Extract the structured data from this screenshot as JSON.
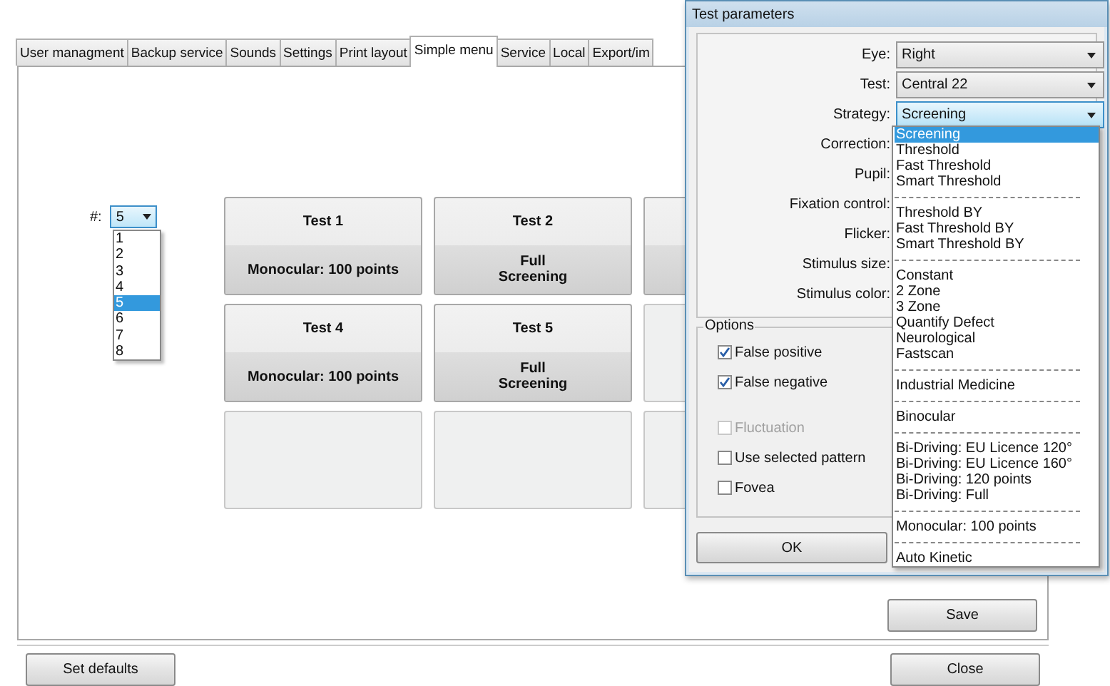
{
  "tabs": [
    {
      "label": "User managment",
      "selected": false
    },
    {
      "label": "Backup service",
      "selected": false
    },
    {
      "label": "Sounds",
      "selected": false
    },
    {
      "label": "Settings",
      "selected": false
    },
    {
      "label": "Print layout",
      "selected": false
    },
    {
      "label": "Simple menu",
      "selected": true
    },
    {
      "label": "Service",
      "selected": false
    },
    {
      "label": "Local",
      "selected": false
    },
    {
      "label": "Export/im",
      "selected": false
    }
  ],
  "count_selector": {
    "label": "#:",
    "value": "5",
    "options": [
      {
        "label": "1",
        "selected": false
      },
      {
        "label": "2",
        "selected": false
      },
      {
        "label": "3",
        "selected": false
      },
      {
        "label": "4",
        "selected": false
      },
      {
        "label": "5",
        "selected": true
      },
      {
        "label": "6",
        "selected": false
      },
      {
        "label": "7",
        "selected": false
      },
      {
        "label": "8",
        "selected": false
      }
    ]
  },
  "tiles": [
    {
      "kind": "test",
      "title": "Test 1",
      "subtitle": "Monocular: 100 points"
    },
    {
      "kind": "test",
      "title": "Test 2",
      "subtitle": "Full\nScreening"
    },
    {
      "kind": "test"
    },
    {
      "kind": "test",
      "title": "Test 4",
      "subtitle": "Monocular: 100 points"
    },
    {
      "kind": "test",
      "title": "Test 5",
      "subtitle": "Full\nScreening"
    },
    {
      "kind": "empty"
    },
    {
      "kind": "empty"
    },
    {
      "kind": "empty"
    },
    {
      "kind": "empty"
    }
  ],
  "save_button": "Save",
  "set_defaults_button": "Set defaults",
  "close_button": "Close",
  "dialog": {
    "title": "Test parameters",
    "fields": [
      {
        "label": "Eye:",
        "value": "Right",
        "focused": false
      },
      {
        "label": "Test:",
        "value": "Central 22",
        "focused": false
      },
      {
        "label": "Strategy:",
        "value": "Screening",
        "focused": true
      },
      {
        "label": "Correction:"
      },
      {
        "label": "Pupil:"
      },
      {
        "label": "Fixation control:"
      },
      {
        "label": "Flicker:"
      },
      {
        "label": "Stimulus size:"
      },
      {
        "label": "Stimulus color:"
      }
    ],
    "options_title": "Options",
    "options": [
      {
        "label": "False positive",
        "checked": true,
        "disabled": false
      },
      {
        "label": "False negative",
        "checked": true,
        "disabled": false
      },
      {
        "label": "Fluctuation",
        "checked": false,
        "disabled": true
      },
      {
        "label": "Use selected pattern",
        "checked": false,
        "disabled": false
      },
      {
        "label": "Fovea",
        "checked": false,
        "disabled": false
      }
    ],
    "ok_button": "OK",
    "strategy_list": [
      {
        "kind": "option",
        "label": "Screening",
        "selected": true
      },
      {
        "kind": "option",
        "label": "Threshold",
        "selected": false
      },
      {
        "kind": "option",
        "label": "Fast Threshold",
        "selected": false
      },
      {
        "kind": "option",
        "label": "Smart Threshold",
        "selected": false
      },
      {
        "kind": "separator"
      },
      {
        "kind": "option",
        "label": "Threshold BY",
        "selected": false
      },
      {
        "kind": "option",
        "label": "Fast Threshold BY",
        "selected": false
      },
      {
        "kind": "option",
        "label": "Smart Threshold BY",
        "selected": false
      },
      {
        "kind": "separator"
      },
      {
        "kind": "option",
        "label": "Constant",
        "selected": false
      },
      {
        "kind": "option",
        "label": "2 Zone",
        "selected": false
      },
      {
        "kind": "option",
        "label": "3 Zone",
        "selected": false
      },
      {
        "kind": "option",
        "label": "Quantify Defect",
        "selected": false
      },
      {
        "kind": "option",
        "label": "Neurological",
        "selected": false
      },
      {
        "kind": "option",
        "label": "Fastscan",
        "selected": false
      },
      {
        "kind": "separator"
      },
      {
        "kind": "option",
        "label": "Industrial Medicine",
        "selected": false
      },
      {
        "kind": "separator"
      },
      {
        "kind": "option",
        "label": "Binocular",
        "selected": false
      },
      {
        "kind": "separator"
      },
      {
        "kind": "option",
        "label": "Bi-Driving: EU Licence 120°",
        "selected": false
      },
      {
        "kind": "option",
        "label": "Bi-Driving: EU Licence 160°",
        "selected": false
      },
      {
        "kind": "option",
        "label": "Bi-Driving: 120 points",
        "selected": false
      },
      {
        "kind": "option",
        "label": "Bi-Driving: Full",
        "selected": false
      },
      {
        "kind": "separator"
      },
      {
        "kind": "option",
        "label": "Monocular: 100 points",
        "selected": false
      },
      {
        "kind": "separator"
      },
      {
        "kind": "option",
        "label": "Auto Kinetic",
        "selected": false
      }
    ]
  }
}
